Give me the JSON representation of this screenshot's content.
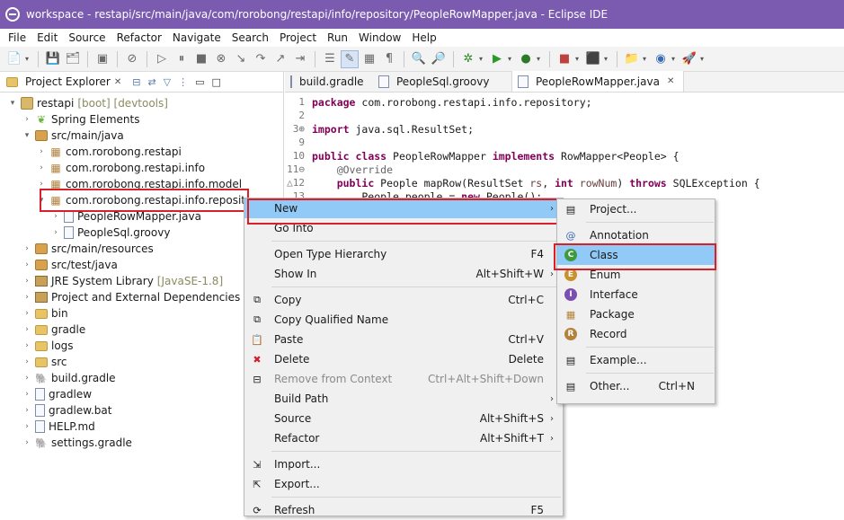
{
  "window": {
    "title": "workspace - restapi/src/main/java/com/rorobong/restapi/info/repository/PeopleRowMapper.java - Eclipse IDE"
  },
  "menubar": [
    "File",
    "Edit",
    "Source",
    "Refactor",
    "Navigate",
    "Search",
    "Project",
    "Run",
    "Window",
    "Help"
  ],
  "explorer": {
    "tab_title": "Project Explorer",
    "close_glyph": "✕",
    "tree": [
      {
        "label": "restapi",
        "decoration": "[boot] [devtools]",
        "arrow": "▾",
        "icon": "project-icon"
      },
      {
        "label": "Spring Elements",
        "decoration": "",
        "arrow": "›",
        "icon": "spring-leaf-icon"
      },
      {
        "label": "src/main/java",
        "decoration": "",
        "arrow": "▾",
        "icon": "source-folder-icon"
      },
      {
        "label": "com.rorobong.restapi",
        "decoration": "",
        "arrow": "›",
        "icon": "package-icon"
      },
      {
        "label": "com.rorobong.restapi.info",
        "decoration": "",
        "arrow": "›",
        "icon": "package-icon"
      },
      {
        "label": "com.rorobong.restapi.info.model",
        "decoration": "",
        "arrow": "›",
        "icon": "package-icon"
      },
      {
        "label": "com.rorobong.restapi.info.repository",
        "decoration": "",
        "arrow": "▾",
        "icon": "package-icon"
      },
      {
        "label": "PeopleRowMapper.java",
        "decoration": "",
        "arrow": "›",
        "icon": "java-file-icon"
      },
      {
        "label": "PeopleSql.groovy",
        "decoration": "",
        "arrow": "›",
        "icon": "groovy-file-icon"
      },
      {
        "label": "src/main/resources",
        "decoration": "",
        "arrow": "›",
        "icon": "source-folder-icon"
      },
      {
        "label": "src/test/java",
        "decoration": "",
        "arrow": "›",
        "icon": "source-folder-icon"
      },
      {
        "label": "JRE System Library",
        "decoration": "[JavaSE-1.8]",
        "arrow": "›",
        "icon": "library-icon"
      },
      {
        "label": "Project and External Dependencies",
        "decoration": "",
        "arrow": "›",
        "icon": "library-icon"
      },
      {
        "label": "bin",
        "decoration": "",
        "arrow": "›",
        "icon": "folder-icon"
      },
      {
        "label": "gradle",
        "decoration": "",
        "arrow": "›",
        "icon": "folder-icon"
      },
      {
        "label": "logs",
        "decoration": "",
        "arrow": "›",
        "icon": "folder-icon"
      },
      {
        "label": "src",
        "decoration": "",
        "arrow": "›",
        "icon": "folder-icon"
      },
      {
        "label": "build.gradle",
        "decoration": "",
        "arrow": "›",
        "icon": "gradle-icon"
      },
      {
        "label": "gradlew",
        "decoration": "",
        "arrow": "›",
        "icon": "file-icon"
      },
      {
        "label": "gradlew.bat",
        "decoration": "",
        "arrow": "›",
        "icon": "file-icon"
      },
      {
        "label": "HELP.md",
        "decoration": "",
        "arrow": "›",
        "icon": "file-icon"
      },
      {
        "label": "settings.gradle",
        "decoration": "",
        "arrow": "›",
        "icon": "gradle-icon"
      }
    ]
  },
  "editor": {
    "tabs": [
      {
        "label": "build.gradle",
        "active": false
      },
      {
        "label": "PeopleSql.groovy",
        "active": false
      },
      {
        "label": "PeopleRowMapper.java",
        "active": true
      }
    ],
    "close_glyph": "✕",
    "lines": [
      {
        "num": "1",
        "parts": [
          [
            "kw",
            "package"
          ],
          [
            "",
            " com.rorobong.restapi.info.repository;"
          ]
        ]
      },
      {
        "num": "2",
        "parts": []
      },
      {
        "num": "3⊕",
        "parts": [
          [
            "kw",
            "import"
          ],
          [
            "",
            " java.sql.ResultSet;"
          ]
        ]
      },
      {
        "num": "9",
        "parts": []
      },
      {
        "num": "10",
        "parts": [
          [
            "kw",
            "public"
          ],
          [
            "",
            " "
          ],
          [
            "kw",
            "class"
          ],
          [
            "",
            " PeopleRowMapper "
          ],
          [
            "kw",
            "implements"
          ],
          [
            "",
            " RowMapper<People> {"
          ]
        ]
      },
      {
        "num": "11⊖",
        "parts": [
          [
            "",
            "    "
          ],
          [
            "ann",
            "@Override"
          ]
        ]
      },
      {
        "num": "△12",
        "parts": [
          [
            "",
            "    "
          ],
          [
            "kw",
            "public"
          ],
          [
            "",
            " People mapRow(ResultSet "
          ],
          [
            "par",
            "rs"
          ],
          [
            "",
            ", "
          ],
          [
            "kw",
            "int"
          ],
          [
            "",
            " "
          ],
          [
            "par",
            "rowNum"
          ],
          [
            "",
            ") "
          ],
          [
            "kw",
            "throws"
          ],
          [
            "",
            " SQLException {"
          ]
        ]
      },
      {
        "num": "13",
        "parts": [
          [
            "",
            "        People people = "
          ],
          [
            "kw",
            "new"
          ],
          [
            "",
            " People();"
          ]
        ]
      }
    ]
  },
  "context_menu": {
    "items": [
      {
        "label": "New",
        "accel": "",
        "submenu": true,
        "selected": true,
        "disabled": false,
        "icon": ""
      },
      {
        "label": "Go Into",
        "accel": "",
        "submenu": false,
        "selected": false,
        "disabled": false,
        "icon": ""
      },
      {
        "sep": true
      },
      {
        "label": "Open Type Hierarchy",
        "accel": "F4",
        "submenu": false,
        "selected": false,
        "disabled": false,
        "icon": ""
      },
      {
        "label": "Show In",
        "accel": "Alt+Shift+W",
        "submenu": true,
        "selected": false,
        "disabled": false,
        "icon": ""
      },
      {
        "sep": true
      },
      {
        "label": "Copy",
        "accel": "Ctrl+C",
        "submenu": false,
        "selected": false,
        "disabled": false,
        "icon": "copy-icon"
      },
      {
        "label": "Copy Qualified Name",
        "accel": "",
        "submenu": false,
        "selected": false,
        "disabled": false,
        "icon": "copy-icon"
      },
      {
        "label": "Paste",
        "accel": "Ctrl+V",
        "submenu": false,
        "selected": false,
        "disabled": false,
        "icon": "paste-icon"
      },
      {
        "label": "Delete",
        "accel": "Delete",
        "submenu": false,
        "selected": false,
        "disabled": false,
        "icon": "delete-icon"
      },
      {
        "label": "Remove from Context",
        "accel": "Ctrl+Alt+Shift+Down",
        "submenu": false,
        "selected": false,
        "disabled": true,
        "icon": "remove-icon"
      },
      {
        "label": "Build Path",
        "accel": "",
        "submenu": true,
        "selected": false,
        "disabled": false,
        "icon": ""
      },
      {
        "label": "Source",
        "accel": "Alt+Shift+S",
        "submenu": true,
        "selected": false,
        "disabled": false,
        "icon": ""
      },
      {
        "label": "Refactor",
        "accel": "Alt+Shift+T",
        "submenu": true,
        "selected": false,
        "disabled": false,
        "icon": ""
      },
      {
        "sep": true
      },
      {
        "label": "Import...",
        "accel": "",
        "submenu": false,
        "selected": false,
        "disabled": false,
        "icon": "import-icon"
      },
      {
        "label": "Export...",
        "accel": "",
        "submenu": false,
        "selected": false,
        "disabled": false,
        "icon": "export-icon"
      },
      {
        "sep": true
      },
      {
        "label": "Refresh",
        "accel": "F5",
        "submenu": false,
        "selected": false,
        "disabled": false,
        "icon": "refresh-icon"
      }
    ]
  },
  "new_submenu": {
    "items": [
      {
        "label": "Project...",
        "accel": "",
        "selected": false,
        "icon": "new-project-icon"
      },
      {
        "sep": true
      },
      {
        "label": "Annotation",
        "accel": "",
        "selected": false,
        "icon": "annotation-icon"
      },
      {
        "label": "Class",
        "accel": "",
        "selected": true,
        "icon": "class-icon"
      },
      {
        "label": "Enum",
        "accel": "",
        "selected": false,
        "icon": "enum-icon"
      },
      {
        "label": "Interface",
        "accel": "",
        "selected": false,
        "icon": "interface-icon"
      },
      {
        "label": "Package",
        "accel": "",
        "selected": false,
        "icon": "package-icon"
      },
      {
        "label": "Record",
        "accel": "",
        "selected": false,
        "icon": "record-icon"
      },
      {
        "sep": true
      },
      {
        "label": "Example...",
        "accel": "",
        "selected": false,
        "icon": "example-icon"
      },
      {
        "sep": true
      },
      {
        "label": "Other...",
        "accel": "Ctrl+N",
        "selected": false,
        "icon": "other-icon"
      }
    ]
  },
  "colors": {
    "titlebar": "#7b5bb0",
    "selection": "#91c9f7",
    "highlight_box": "#d7202a",
    "keyword": "#7f0055"
  }
}
